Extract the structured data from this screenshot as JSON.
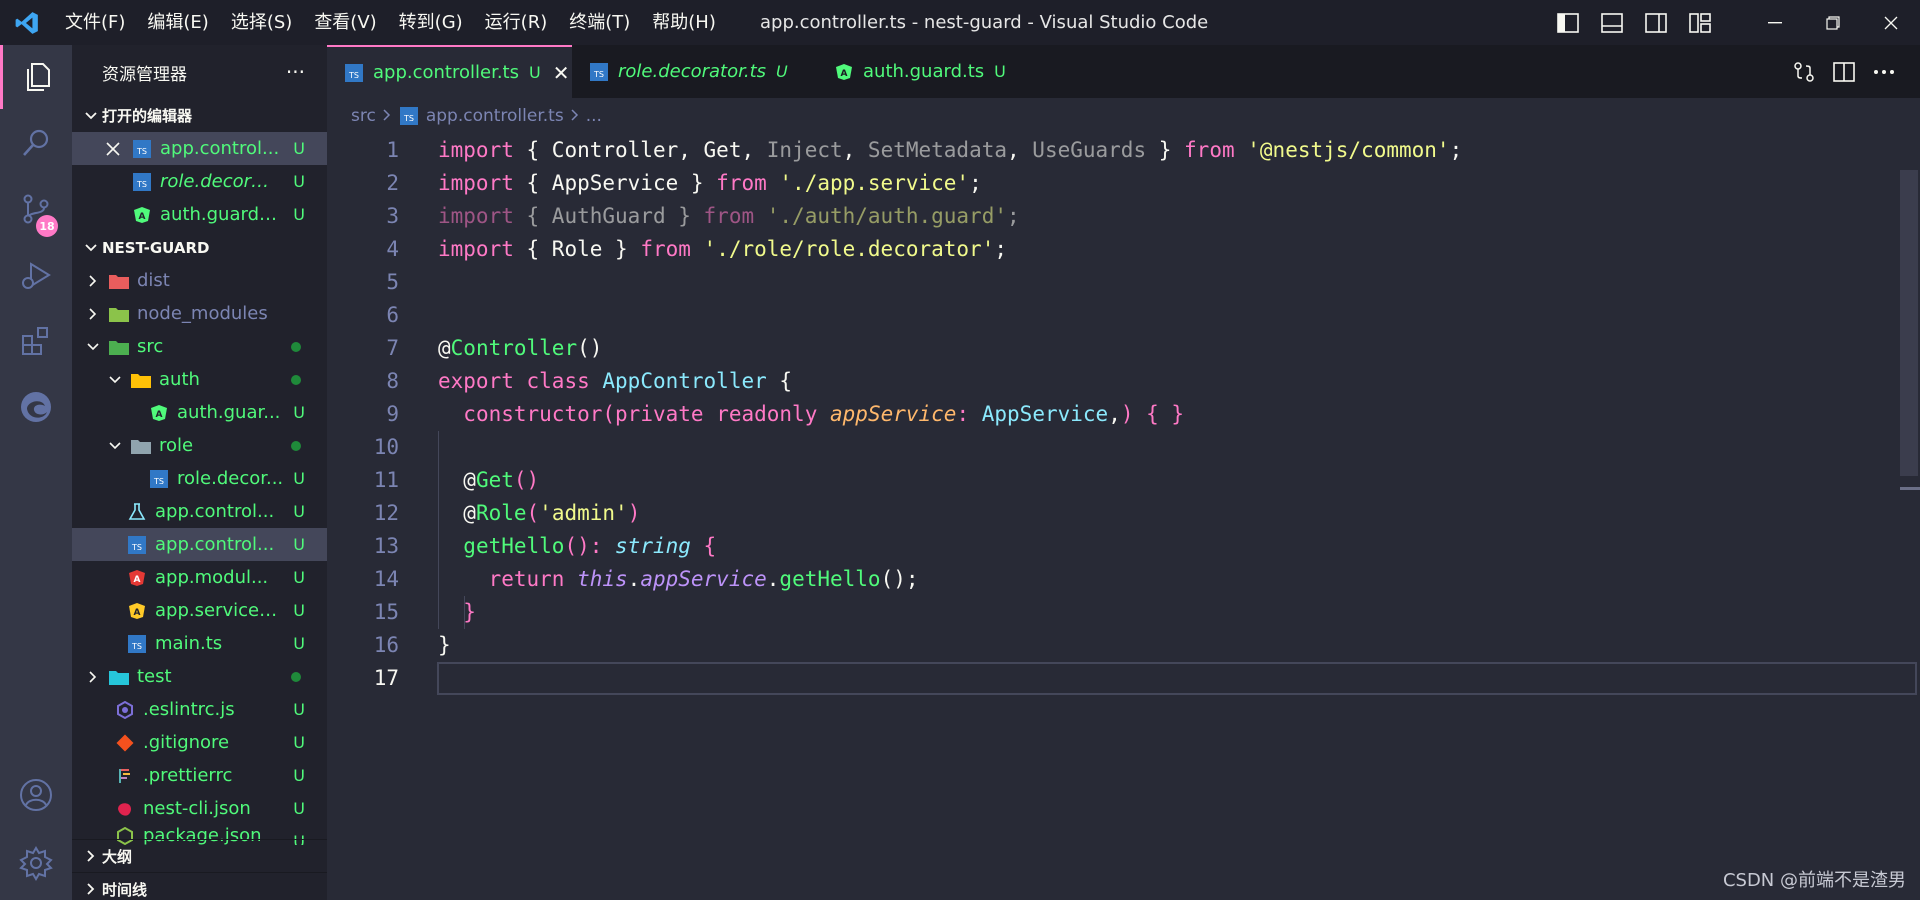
{
  "menubar": {
    "items": [
      "文件(F)",
      "编辑(E)",
      "选择(S)",
      "查看(V)",
      "转到(G)",
      "运行(R)",
      "终端(T)",
      "帮助(H)"
    ]
  },
  "window": {
    "title": "app.controller.ts - nest-guard - Visual Studio Code"
  },
  "activity_bar": {
    "source_control_badge": "18"
  },
  "sidebar": {
    "title": "资源管理器",
    "more": "···",
    "open_editors": {
      "header": "打开的编辑器",
      "items": [
        {
          "label": "app.control...",
          "status": "U"
        },
        {
          "label": "role.decorat...",
          "status": "U"
        },
        {
          "label": "auth.guard....",
          "status": "U"
        }
      ]
    },
    "project": {
      "header": "NEST-GUARD",
      "items": [
        {
          "label": "dist",
          "status": ""
        },
        {
          "label": "node_modules",
          "status": ""
        },
        {
          "label": "src",
          "status": ""
        },
        {
          "label": "auth",
          "status": ""
        },
        {
          "label": "auth.guar...",
          "status": "U"
        },
        {
          "label": "role",
          "status": ""
        },
        {
          "label": "role.decor...",
          "status": "U"
        },
        {
          "label": "app.control...",
          "status": "U"
        },
        {
          "label": "app.control...",
          "status": "U"
        },
        {
          "label": "app.modul...",
          "status": "U"
        },
        {
          "label": "app.service.ts",
          "status": "U"
        },
        {
          "label": "main.ts",
          "status": "U"
        },
        {
          "label": "test",
          "status": ""
        },
        {
          "label": ".eslintrc.js",
          "status": "U"
        },
        {
          "label": ".gitignore",
          "status": "U"
        },
        {
          "label": ".prettierrc",
          "status": "U"
        },
        {
          "label": "nest-cli.json",
          "status": "U"
        },
        {
          "label": "package.json",
          "status": "U"
        }
      ]
    },
    "outline": {
      "header": "大纲"
    },
    "timeline": {
      "header": "时间线"
    }
  },
  "tabs": [
    {
      "label": "app.controller.ts",
      "status": "U",
      "close": "✕"
    },
    {
      "label": "role.decorator.ts",
      "status": "U"
    },
    {
      "label": "auth.guard.ts",
      "status": "U"
    }
  ],
  "breadcrumb": {
    "folder": "src",
    "file": "app.controller.ts",
    "more": "..."
  },
  "code": {
    "line_numbers": [
      "1",
      "2",
      "3",
      "4",
      "5",
      "6",
      "7",
      "8",
      "9",
      "10",
      "11",
      "12",
      "13",
      "14",
      "15",
      "16",
      "17"
    ],
    "lines": [
      [
        {
          "t": "import",
          "c": "k"
        },
        {
          "t": " { ",
          "c": "p"
        },
        {
          "t": "Controller",
          "c": "p"
        },
        {
          "t": ", ",
          "c": "p"
        },
        {
          "t": "Get",
          "c": "p"
        },
        {
          "t": ", ",
          "c": "p"
        },
        {
          "t": "Inject",
          "c": "p faded"
        },
        {
          "t": ", ",
          "c": "p"
        },
        {
          "t": "SetMetadata",
          "c": "p faded"
        },
        {
          "t": ", ",
          "c": "p"
        },
        {
          "t": "UseGuards",
          "c": "p faded"
        },
        {
          "t": " } ",
          "c": "p"
        },
        {
          "t": "from",
          "c": "k"
        },
        {
          "t": " ",
          "c": "p"
        },
        {
          "t": "'@nestjs/common'",
          "c": "s"
        },
        {
          "t": ";",
          "c": "p"
        }
      ],
      [
        {
          "t": "import",
          "c": "k"
        },
        {
          "t": " { ",
          "c": "p"
        },
        {
          "t": "AppService",
          "c": "p"
        },
        {
          "t": " } ",
          "c": "p"
        },
        {
          "t": "from",
          "c": "k"
        },
        {
          "t": " ",
          "c": "p"
        },
        {
          "t": "'./app.service'",
          "c": "s"
        },
        {
          "t": ";",
          "c": "p"
        }
      ],
      [
        {
          "t": "import",
          "c": "k faded"
        },
        {
          "t": " { ",
          "c": "p faded"
        },
        {
          "t": "AuthGuard",
          "c": "p faded"
        },
        {
          "t": " } ",
          "c": "p faded"
        },
        {
          "t": "from",
          "c": "k faded"
        },
        {
          "t": " ",
          "c": "p"
        },
        {
          "t": "'./auth/auth.guard'",
          "c": "s faded"
        },
        {
          "t": ";",
          "c": "p faded"
        }
      ],
      [
        {
          "t": "import",
          "c": "k"
        },
        {
          "t": " { ",
          "c": "p"
        },
        {
          "t": "Role",
          "c": "p"
        },
        {
          "t": " } ",
          "c": "p"
        },
        {
          "t": "from",
          "c": "k"
        },
        {
          "t": " ",
          "c": "p"
        },
        {
          "t": "'./role/role.decorator'",
          "c": "s"
        },
        {
          "t": ";",
          "c": "p"
        }
      ],
      [],
      [],
      [
        {
          "t": "@",
          "c": "p"
        },
        {
          "t": "Controller",
          "c": "f"
        },
        {
          "t": "()",
          "c": "p"
        }
      ],
      [
        {
          "t": "export",
          "c": "k"
        },
        {
          "t": " ",
          "c": "p"
        },
        {
          "t": "class",
          "c": "k"
        },
        {
          "t": " ",
          "c": "p"
        },
        {
          "t": "AppController",
          "c": "c"
        },
        {
          "t": " {",
          "c": "p"
        }
      ],
      [
        {
          "t": "  ",
          "c": "p"
        },
        {
          "t": "constructor",
          "c": "k"
        },
        {
          "t": "(",
          "c": "k"
        },
        {
          "t": "private",
          "c": "k"
        },
        {
          "t": " ",
          "c": "p"
        },
        {
          "t": "readonly",
          "c": "k"
        },
        {
          "t": " ",
          "c": "p"
        },
        {
          "t": "appService",
          "c": "o"
        },
        {
          "t": ": ",
          "c": "k"
        },
        {
          "t": "AppService",
          "c": "c"
        },
        {
          "t": ",",
          "c": "p"
        },
        {
          "t": ")",
          "c": "k"
        },
        {
          "t": " { }",
          "c": "k"
        }
      ],
      [],
      [
        {
          "t": "  @",
          "c": "p"
        },
        {
          "t": "Get",
          "c": "f"
        },
        {
          "t": "()",
          "c": "k"
        }
      ],
      [
        {
          "t": "  @",
          "c": "p"
        },
        {
          "t": "Role",
          "c": "f"
        },
        {
          "t": "(",
          "c": "k"
        },
        {
          "t": "'admin'",
          "c": "s"
        },
        {
          "t": ")",
          "c": "k"
        }
      ],
      [
        {
          "t": "  ",
          "c": "p"
        },
        {
          "t": "getHello",
          "c": "f"
        },
        {
          "t": "(): ",
          "c": "k"
        },
        {
          "t": "string",
          "c": "m"
        },
        {
          "t": " {",
          "c": "k"
        }
      ],
      [
        {
          "t": "    ",
          "c": "p"
        },
        {
          "t": "return",
          "c": "k"
        },
        {
          "t": " ",
          "c": "p"
        },
        {
          "t": "this",
          "c": "i"
        },
        {
          "t": ".",
          "c": "p"
        },
        {
          "t": "appService",
          "c": "i"
        },
        {
          "t": ".",
          "c": "p"
        },
        {
          "t": "getHello",
          "c": "f"
        },
        {
          "t": "();",
          "c": "p"
        }
      ],
      [
        {
          "t": "  }",
          "c": "k"
        }
      ],
      [
        {
          "t": "}",
          "c": "p"
        }
      ],
      []
    ]
  },
  "watermark": "CSDN @前端不是渣男",
  "colors": {
    "accent": "#ff79c6",
    "untracked": "#50fa7b",
    "background": "#282a36"
  }
}
